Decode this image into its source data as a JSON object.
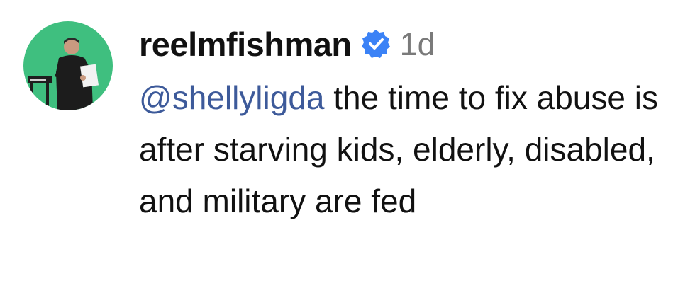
{
  "comment": {
    "username": "reelmfishman",
    "verified": true,
    "timestamp": "1d",
    "mention": "@shellyligda",
    "text": " the time to fix abuse is after starving kids, elderly, disabled, and military are fed"
  },
  "colors": {
    "mention": "#3d5a9a",
    "verified_badge": "#3b82f6",
    "timestamp": "#7a7a7a",
    "avatar_background": "#3fbf7f"
  },
  "icons": {
    "verified": "verified-check-icon"
  }
}
